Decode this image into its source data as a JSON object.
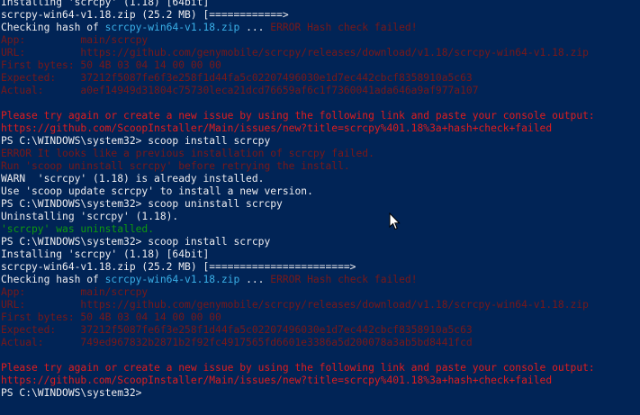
{
  "terminal": {
    "colors": {
      "background": "#012456",
      "text": "#eeedf0",
      "cyan": "#3ab0e8",
      "error_red": "#e01d1d",
      "dim_red": "#7a1818",
      "green": "#0e9a0e"
    },
    "lines": [
      {
        "segments": [
          {
            "text": "Installing 'scrcpy' (1.18) [64bit]",
            "color": "white"
          }
        ]
      },
      {
        "segments": [
          {
            "text": "scrcpy-win64-v1.18.zip (25.2 MB) [============>",
            "color": "white"
          }
        ]
      },
      {
        "segments": [
          {
            "text": "Checking hash of ",
            "color": "white"
          },
          {
            "text": "scrcpy-win64-v1.18.zip",
            "color": "cyan"
          },
          {
            "text": " ... ",
            "color": "white"
          },
          {
            "text": "ERROR Hash check failed!",
            "color": "dimred"
          }
        ]
      },
      {
        "segments": [
          {
            "text": "App:         main/scrcpy",
            "color": "dimred"
          }
        ]
      },
      {
        "segments": [
          {
            "text": "URL:         https://github.com/genymobile/scrcpy/releases/download/v1.18/scrcpy-win64-v1.18.zip",
            "color": "dimred"
          }
        ]
      },
      {
        "segments": [
          {
            "text": "First bytes: 50 4B 03 04 14 00 00 00",
            "color": "dimred"
          }
        ]
      },
      {
        "segments": [
          {
            "text": "Expected:    37212f5087fe6f3e258f1d44fa5c02207496030e1d7ec442cbcf8358910a5c63",
            "color": "dimred"
          }
        ]
      },
      {
        "segments": [
          {
            "text": "Actual:      a0ef14949d31804c75730leca21dcd76659af6c1f7360041ada646a9af977a107",
            "color": "dimred"
          }
        ]
      },
      {
        "segments": [
          {
            "text": "",
            "color": "white"
          }
        ]
      },
      {
        "segments": [
          {
            "text": "Please try again or create a new issue by using the following link and paste your console output:",
            "color": "red"
          }
        ]
      },
      {
        "segments": [
          {
            "text": "https://github.com/ScoopInstaller/Main/issues/new?title=scrcpy%401.18%3a+hash+check+failed",
            "color": "red"
          }
        ]
      },
      {
        "segments": [
          {
            "text": "PS C:\\WINDOWS\\system32> scoop install scrcpy",
            "color": "white"
          }
        ]
      },
      {
        "segments": [
          {
            "text": "ERROR It looks like a previous installation of scrcpy failed.",
            "color": "dimred"
          }
        ]
      },
      {
        "segments": [
          {
            "text": "Run 'scoop uninstall scrcpy' before retrying the install.",
            "color": "dimred"
          }
        ]
      },
      {
        "segments": [
          {
            "text": "WARN  'scrcpy' (1.18) is already installed.",
            "color": "white"
          }
        ]
      },
      {
        "segments": [
          {
            "text": "Use 'scoop update scrcpy' to install a new version.",
            "color": "white"
          }
        ]
      },
      {
        "segments": [
          {
            "text": "PS C:\\WINDOWS\\system32> scoop uninstall scrcpy",
            "color": "white"
          }
        ]
      },
      {
        "segments": [
          {
            "text": "Uninstalling 'scrcpy' (1.18).",
            "color": "white"
          }
        ]
      },
      {
        "segments": [
          {
            "text": "'scrcpy' was uninstalled.",
            "color": "green"
          }
        ]
      },
      {
        "segments": [
          {
            "text": "PS C:\\WINDOWS\\system32> scoop install scrcpy",
            "color": "white"
          }
        ]
      },
      {
        "segments": [
          {
            "text": "Installing 'scrcpy' (1.18) [64bit]",
            "color": "white"
          }
        ]
      },
      {
        "segments": [
          {
            "text": "scrcpy-win64-v1.18.zip (25.2 MB) [=======================>",
            "color": "white"
          }
        ]
      },
      {
        "segments": [
          {
            "text": "Checking hash of ",
            "color": "white"
          },
          {
            "text": "scrcpy-win64-v1.18.zip",
            "color": "cyan"
          },
          {
            "text": " ... ",
            "color": "white"
          },
          {
            "text": "ERROR Hash check failed!",
            "color": "dimred"
          }
        ]
      },
      {
        "segments": [
          {
            "text": "App:         main/scrcpy",
            "color": "dimred"
          }
        ]
      },
      {
        "segments": [
          {
            "text": "URL:         https://github.com/genymobile/scrcpy/releases/download/v1.18/scrcpy-win64-v1.18.zip",
            "color": "dimred"
          }
        ]
      },
      {
        "segments": [
          {
            "text": "First bytes: 50 4B 03 04 14 00 00 00",
            "color": "dimred"
          }
        ]
      },
      {
        "segments": [
          {
            "text": "Expected:    37212f5087fe6f3e258f1d44fa5c02207496030e1d7ec442cbcf8358910a5c63",
            "color": "dimred"
          }
        ]
      },
      {
        "segments": [
          {
            "text": "Actual:      749ed967832b2871b2f92fc4917565fd6601e3386a5d200078a3ab5bd8441fcd",
            "color": "dimred"
          }
        ]
      },
      {
        "segments": [
          {
            "text": "",
            "color": "white"
          }
        ]
      },
      {
        "segments": [
          {
            "text": "Please try again or create a new issue by using the following link and paste your console output:",
            "color": "red"
          }
        ]
      },
      {
        "segments": [
          {
            "text": "https://github.com/ScoopInstaller/Main/issues/new?title=scrcpy%401.18%3a+hash+check+failed",
            "color": "red"
          }
        ]
      },
      {
        "segments": [
          {
            "text": "PS C:\\WINDOWS\\system32>",
            "color": "white"
          }
        ]
      }
    ],
    "cursor_icon": "mouse-pointer-icon"
  }
}
